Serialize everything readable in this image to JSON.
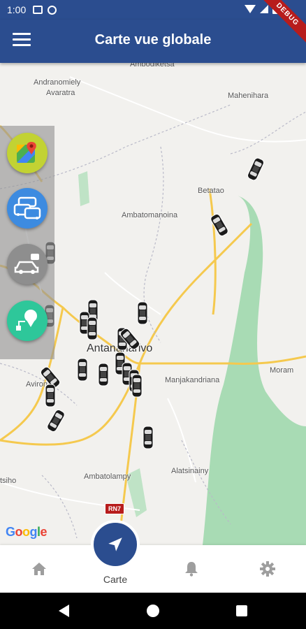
{
  "status_bar": {
    "time": "1:00"
  },
  "app_bar": {
    "title": "Carte vue globale",
    "debug_label": "DEBUG"
  },
  "map": {
    "places": {
      "ambodiketsa": "Ambodiketsa",
      "andranomiely": "Andranomiely",
      "avaratra": "Avaratra",
      "mahenihara": "Mahenihara",
      "betatao": "Betatao",
      "ambatomanoina": "Ambatomanoina",
      "antananarivo": "Antananarivo",
      "moramanga": "Moram",
      "manjakandriana": "Manjakandriana",
      "avironimamo": "Avirona",
      "alatsinainy": "Alatsinainy",
      "ambatolampy": "Ambatolampy",
      "tsiho": "tsiho"
    },
    "road_shield": "RN7",
    "google_logo": "Google",
    "colors": {
      "land": "#f2f1ee",
      "forest": "#a8dbb4",
      "road": "#f5c94e"
    }
  },
  "side_panel": {
    "buttons": [
      {
        "icon": "google-maps-icon"
      },
      {
        "icon": "traffic-icon"
      },
      {
        "icon": "taxi-message-icon"
      },
      {
        "icon": "route-pin-icon"
      }
    ]
  },
  "bottom_nav": {
    "items": [
      {
        "icon": "home-icon"
      },
      {
        "icon": "navigation-arrow-icon",
        "label": "Carte"
      },
      {
        "icon": "bell-icon"
      },
      {
        "icon": "settings-gear-icon"
      }
    ],
    "accent_color": "#2b4d8f"
  }
}
